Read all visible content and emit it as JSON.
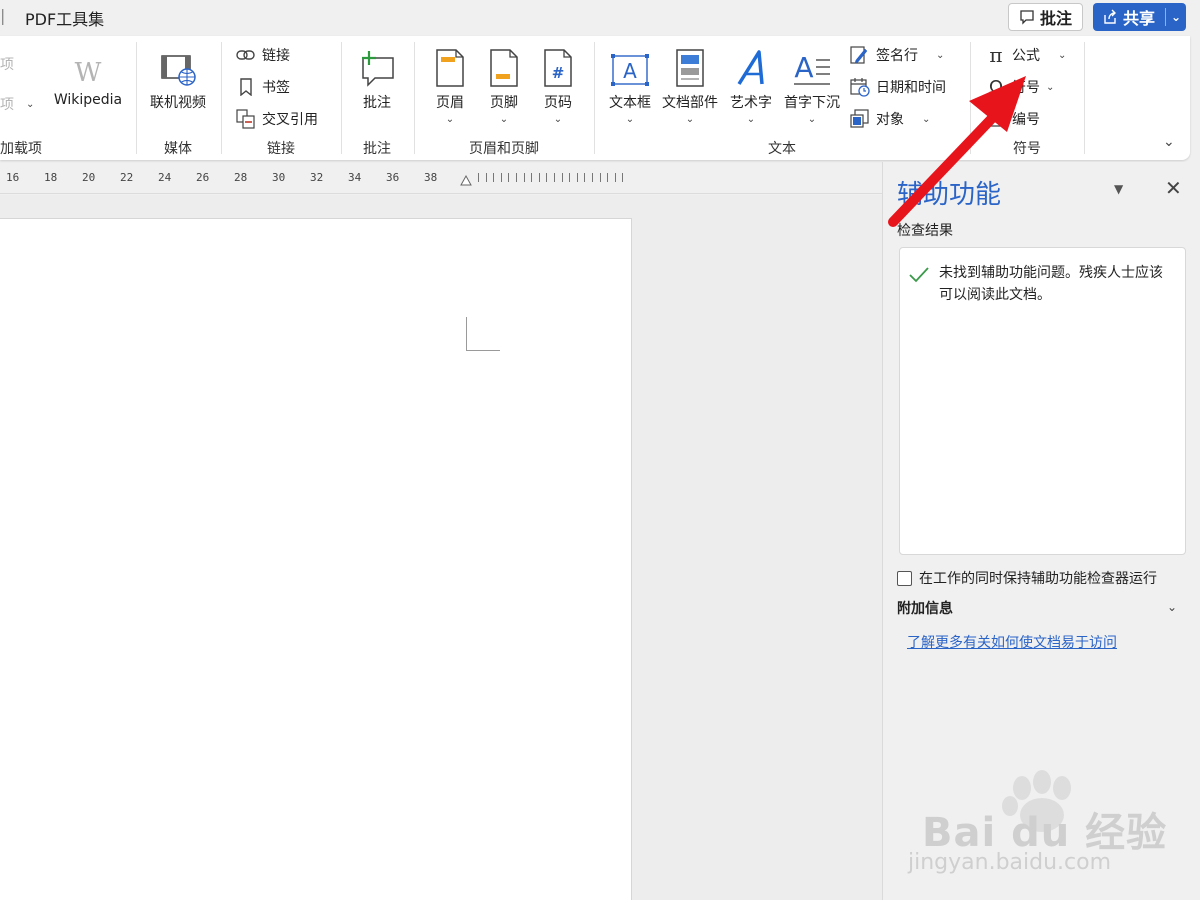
{
  "window": {
    "tabs": [
      {
        "label": "PDF工具集"
      }
    ],
    "comment_button_label": "批注",
    "share_button_label": "共享"
  },
  "ribbon": {
    "addins": {
      "item1": "项",
      "item2": "项",
      "wikipedia": "Wikipedia",
      "group_label": "加载项"
    },
    "media": {
      "online_video": "联机视频",
      "group_label": "媒体"
    },
    "links": {
      "link": "链接",
      "bookmark": "书签",
      "cross_reference": "交叉引用",
      "group_label": "链接"
    },
    "comments": {
      "comment": "批注",
      "group_label": "批注"
    },
    "header_footer": {
      "header": "页眉",
      "footer": "页脚",
      "page_number": "页码",
      "group_label": "页眉和页脚"
    },
    "text": {
      "text_box": "文本框",
      "quick_parts": "文档部件",
      "word_art": "艺术字",
      "drop_cap": "首字下沉",
      "signature_line": "签名行",
      "date_time": "日期和时间",
      "object": "对象",
      "group_label": "文本"
    },
    "symbols": {
      "equation": "公式",
      "symbol": "符号",
      "number": "编号",
      "group_label": "符号"
    }
  },
  "ruler": {
    "labels": [
      "16",
      "18",
      "20",
      "22",
      "24",
      "26",
      "28",
      "30",
      "32",
      "34",
      "36",
      "38"
    ]
  },
  "accessibility_pane": {
    "title": "辅助功能",
    "section_title": "检查结果",
    "result_message": "未找到辅助功能问题。残疾人士应该可以阅读此文档。",
    "keep_running_label": "在工作的同时保持辅助功能检查器运行",
    "keep_running_checked": false,
    "additional_info_title": "附加信息",
    "learn_more_link": "了解更多有关如何使文档易于访问"
  },
  "watermark": {
    "brand": "Bai du 经验",
    "url": "jingyan.baidu.com"
  },
  "colors": {
    "accent": "#2b64c7",
    "annotation_arrow": "#e8141c",
    "check_green": "#3a9a4a"
  }
}
